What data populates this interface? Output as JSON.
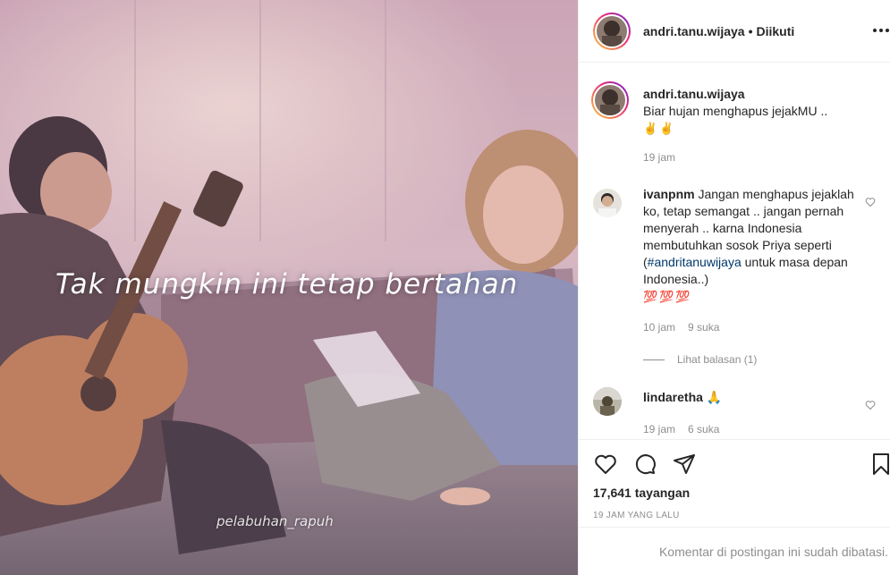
{
  "media": {
    "overlay_caption": "Tak mungkin ini tetap bertahan",
    "watermark": "pelabuhan_rapuh"
  },
  "header": {
    "username": "andri.tanu.wijaya",
    "separator": "•",
    "follow_state": "Diikuti",
    "more_icon": "more-horizontal-icon"
  },
  "caption": {
    "username": "andri.tanu.wijaya",
    "text": "Biar hujan menghapus jejakMU ..",
    "emoji": "✌✌",
    "time": "19 jam"
  },
  "comments": [
    {
      "username": "ivanpnm",
      "text": "Jangan menghapus jejaklah ko, tetap semangat .. jangan pernah menyerah .. karna Indonesia membutuhkan sosok Priya seperti (",
      "hashtag": "#andritanuwijaya",
      "text_after": " untuk masa depan Indonesia..)",
      "emoji": "💯💯💯",
      "time": "10 jam",
      "likes": "9 suka",
      "view_replies": "Lihat balasan (1)"
    },
    {
      "username": "lindaretha",
      "text": " 🙏",
      "time": "19 jam",
      "likes": "6 suka"
    }
  ],
  "actions": {
    "like_icon": "heart-icon",
    "comment_icon": "comment-bubble-icon",
    "share_icon": "paper-plane-icon",
    "save_icon": "bookmark-icon"
  },
  "stats": {
    "views": "17,641 tayangan",
    "posted": "19 JAM YANG LALU"
  },
  "footer": {
    "comments_closed": "Komentar di postingan ini sudah dibatasi."
  },
  "colors": {
    "link": "#00376b",
    "muted": "#8e8e8e",
    "text": "#262626",
    "border": "#efefef"
  }
}
